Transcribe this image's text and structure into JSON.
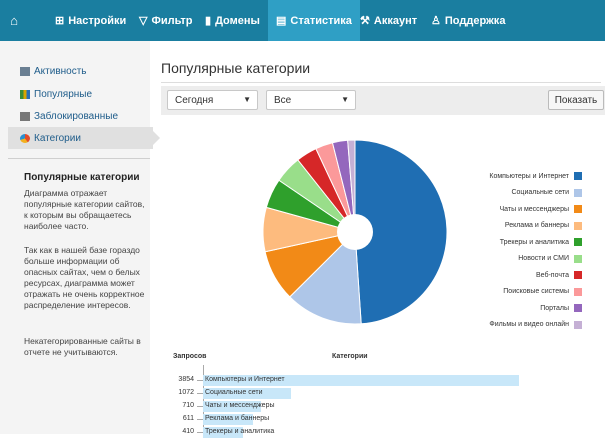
{
  "nav": {
    "home_icon": "home-icon",
    "items": [
      {
        "label": "Настройки",
        "icon": "sitemap-icon"
      },
      {
        "label": "Фильтр",
        "icon": "filter-icon"
      },
      {
        "label": "Домены",
        "icon": "document-icon"
      },
      {
        "label": "Статистика",
        "icon": "chart-icon",
        "active": true
      },
      {
        "label": "Аккаунт",
        "icon": "wrench-icon"
      },
      {
        "label": "Поддержка",
        "icon": "user-icon"
      }
    ]
  },
  "sidebar": {
    "items": [
      {
        "label": "Активность",
        "icon": "activity-icon"
      },
      {
        "label": "Популярные",
        "icon": "bar-chart-icon"
      },
      {
        "label": "Заблокированные",
        "icon": "blocked-icon"
      },
      {
        "label": "Категории",
        "icon": "pie-chart-icon",
        "active": true
      }
    ],
    "info_title": "Популярные категории",
    "info_paragraphs": [
      "Диаграмма отражает популярные категории сайтов, к которым вы обращаетесь наиболее часто.",
      "Так как в нашей базе гораздо больше информации об опасных сайтах, чем о белых ресурсах, диаграмма может отражать не очень корректное распределение интересов.",
      "Некатегорированные сайты в отчете не учитываются."
    ]
  },
  "main": {
    "title": "Популярные категории",
    "filter": {
      "period": "Сегодня",
      "scope": "Все",
      "show_button": "Показать"
    },
    "table_headers": {
      "requests": "Запросов",
      "categories": "Категории"
    }
  },
  "colors": {
    "accent": "#1a7ea0",
    "accent_active": "#2f9fc5",
    "link": "#1e5c8a"
  },
  "chart_data": [
    {
      "type": "pie",
      "legend_position": "right",
      "categories": [
        "Компьютеры и Интернет",
        "Социальные сети",
        "Чаты и мессенджеры",
        "Реклама и баннеры",
        "Трекеры и аналитика",
        "Новости и СМИ",
        "Веб-почта",
        "Поисковые системы",
        "Порталы",
        "Фильмы и видео онлайн"
      ],
      "values": [
        3854,
        1072,
        710,
        611,
        410,
        380,
        290,
        240,
        210,
        100
      ],
      "colors": [
        "#1f6eb3",
        "#aec6e8",
        "#f28a17",
        "#fdbb7e",
        "#2fa02c",
        "#99de8a",
        "#d62728",
        "#fb999a",
        "#9467bd",
        "#c5b0d5"
      ]
    },
    {
      "type": "bar",
      "orientation": "horizontal",
      "categories": [
        "Компьютеры и Интернет",
        "Социальные сети",
        "Чаты и мессенджеры",
        "Реклама и баннеры",
        "Трекеры и аналитика"
      ],
      "values": [
        3854,
        1072,
        710,
        611,
        410
      ]
    }
  ]
}
